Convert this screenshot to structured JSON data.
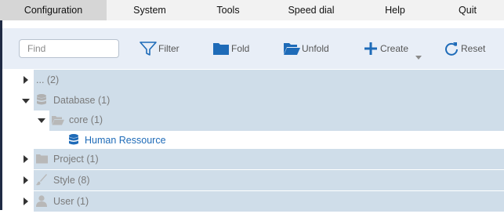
{
  "menu": {
    "items": [
      {
        "label": "Configuration",
        "active": true
      },
      {
        "label": "System"
      },
      {
        "label": "Tools"
      },
      {
        "label": "Speed dial"
      },
      {
        "label": "Help"
      },
      {
        "label": "Quit"
      }
    ]
  },
  "toolbar": {
    "search_placeholder": "Find",
    "search_value": "",
    "filter_label": "Filter",
    "fold_label": "Fold",
    "unfold_label": "Unfold",
    "create_label": "Create",
    "reset_label": "Reset"
  },
  "tree": {
    "rows": [
      {
        "label": "... (2)",
        "expanded": false,
        "icon": "none"
      },
      {
        "label": "Database (1)",
        "expanded": true,
        "icon": "database-icon"
      },
      {
        "label": "core (1)",
        "expanded": true,
        "icon": "folder-open-icon"
      },
      {
        "label": "Human Ressource",
        "icon": "database-icon",
        "selected": true
      },
      {
        "label": "Project (1)",
        "expanded": false,
        "icon": "folder-icon"
      },
      {
        "label": "Style (8)",
        "expanded": false,
        "icon": "brush-icon"
      },
      {
        "label": "User (1)",
        "expanded": false,
        "icon": "user-icon"
      }
    ]
  },
  "colors": {
    "accent": "#1e6bb8",
    "tree_row_bg": "#cfdde9",
    "toolbar_bg": "#e8eef7",
    "menu_active_bg": "#d6d6d6"
  }
}
